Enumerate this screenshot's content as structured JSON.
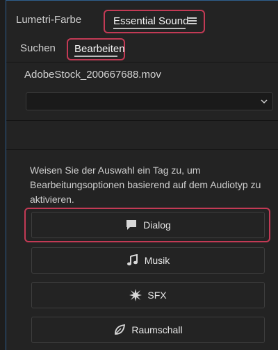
{
  "tabs": {
    "lumetri": "Lumetri-Farbe",
    "essential_sound": "Essential Sound"
  },
  "subtabs": {
    "search": "Suchen",
    "edit": "Bearbeiten"
  },
  "clip": {
    "filename": "AdobeStock_200667688.mov",
    "preset_value": ""
  },
  "hint": "Weisen Sie der Auswahl ein Tag zu, um Bearbeitungsoptionen basierend auf dem Audiotyp zu aktivieren.",
  "buttons": {
    "dialog": "Dialog",
    "music": "Musik",
    "sfx": "SFX",
    "ambience": "Raumschall"
  },
  "colors": {
    "highlight": "#c33a55",
    "panel_border": "#2f5f8e"
  }
}
